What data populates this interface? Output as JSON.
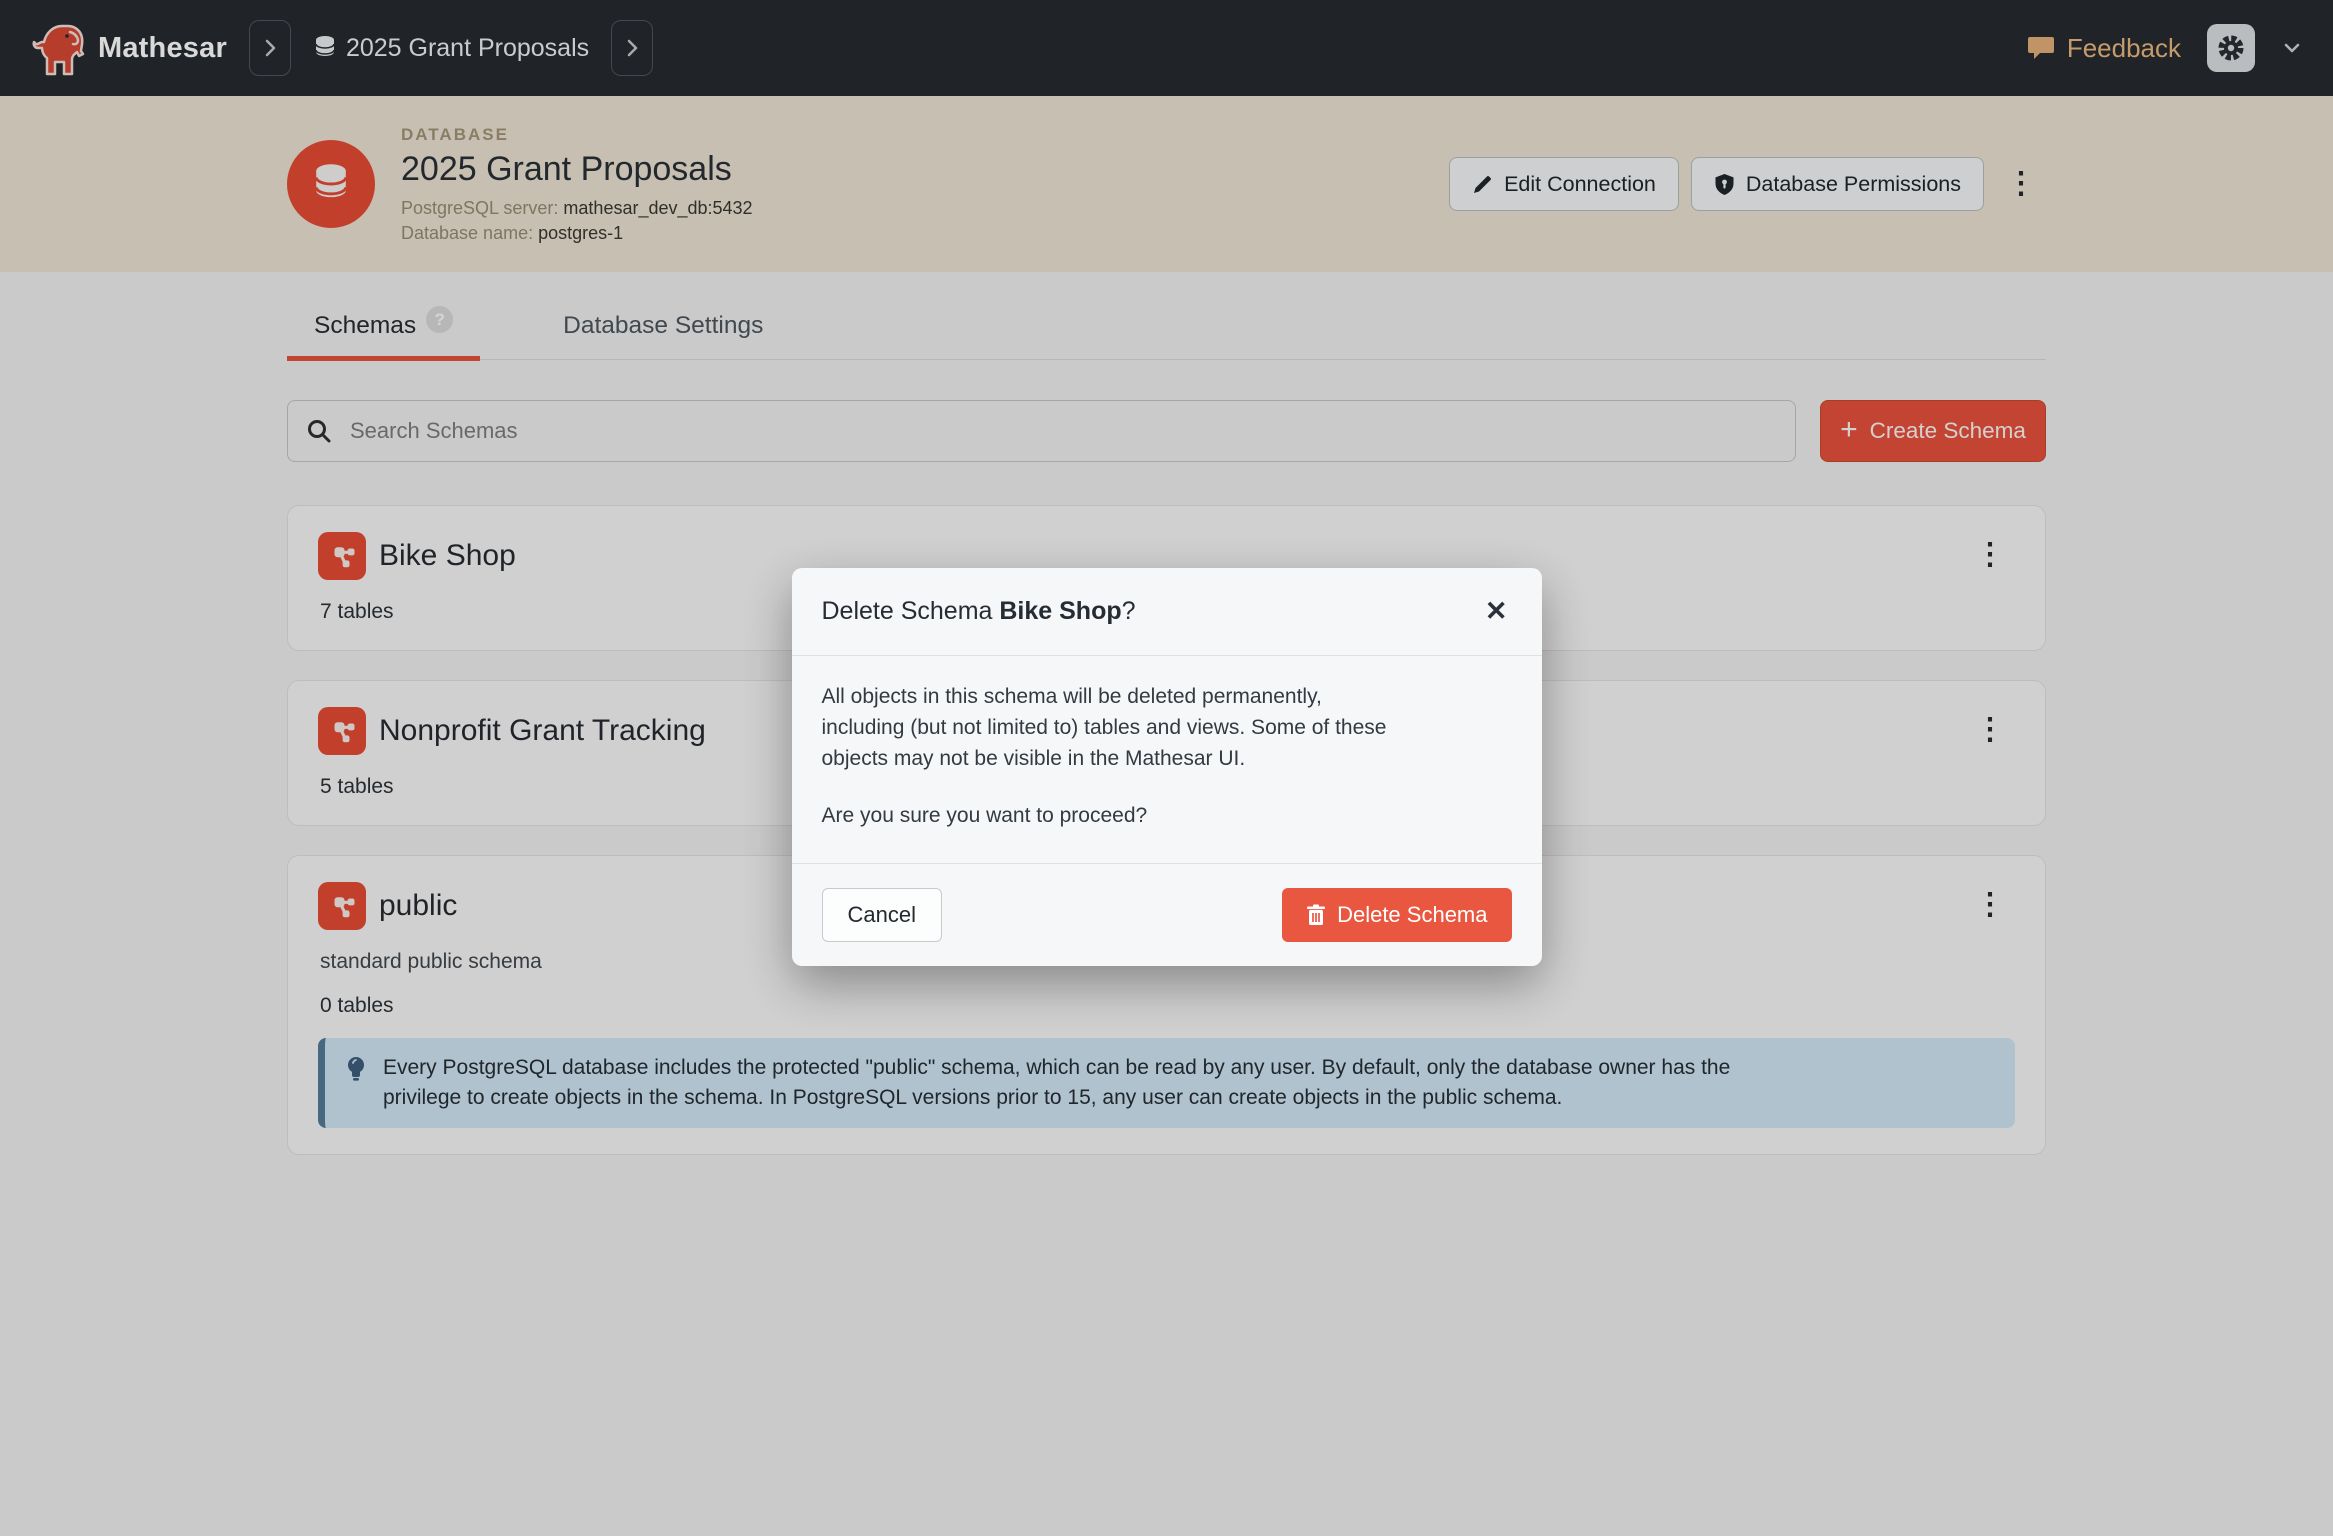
{
  "colors": {
    "brand_red": "#e5513b",
    "delete_red": "#ea5741",
    "navbar_bg": "#262a30",
    "header_tan": "#e9e1d2",
    "note_blue_bg": "#cfe4f3",
    "note_blue_border": "#537b97",
    "feedback_tan": "#e2ae77"
  },
  "icons": {
    "kebab": "⋮",
    "question": "?",
    "close": "✕",
    "plus": "+"
  },
  "navbar": {
    "brand": "Mathesar",
    "breadcrumb_db": "2025 Grant Proposals",
    "feedback_label": "Feedback"
  },
  "header": {
    "kicker": "DATABASE",
    "title": "2025 Grant Proposals",
    "server_label": "PostgreSQL server:",
    "server_value": "mathesar_dev_db:5432",
    "dbname_label": "Database name:",
    "dbname_value": "postgres-1",
    "edit_connection_label": "Edit Connection",
    "permissions_label": "Database Permissions"
  },
  "tabs": [
    {
      "label": "Schemas",
      "active": true
    },
    {
      "label": "Database Settings",
      "active": false
    }
  ],
  "toolbar": {
    "search_placeholder": "Search Schemas",
    "create_label": "Create Schema"
  },
  "schemas": [
    {
      "name": "Bike Shop",
      "tables": "7 tables"
    },
    {
      "name": "Nonprofit Grant Tracking",
      "tables": "5 tables"
    },
    {
      "name": "public",
      "description": "standard public schema",
      "tables": "0 tables",
      "note_lines": [
        "Every PostgreSQL database includes the protected \"public\" schema, which can be read by any user. By default, only the database owner has the",
        "privilege to create objects in the schema. In PostgreSQL versions prior to 15, any user can create objects in the public schema."
      ]
    }
  ],
  "modal": {
    "title_prefix": "Delete Schema ",
    "schema_name": "Bike Shop",
    "title_suffix": "?",
    "body_para1_lines": [
      "All objects in this schema will be deleted permanently,",
      "including (but not limited to) tables and views. Some of these",
      "objects may not be visible in the Mathesar UI."
    ],
    "body_para2": "Are you sure you want to proceed?",
    "cancel_label": "Cancel",
    "confirm_label": "Delete Schema"
  }
}
